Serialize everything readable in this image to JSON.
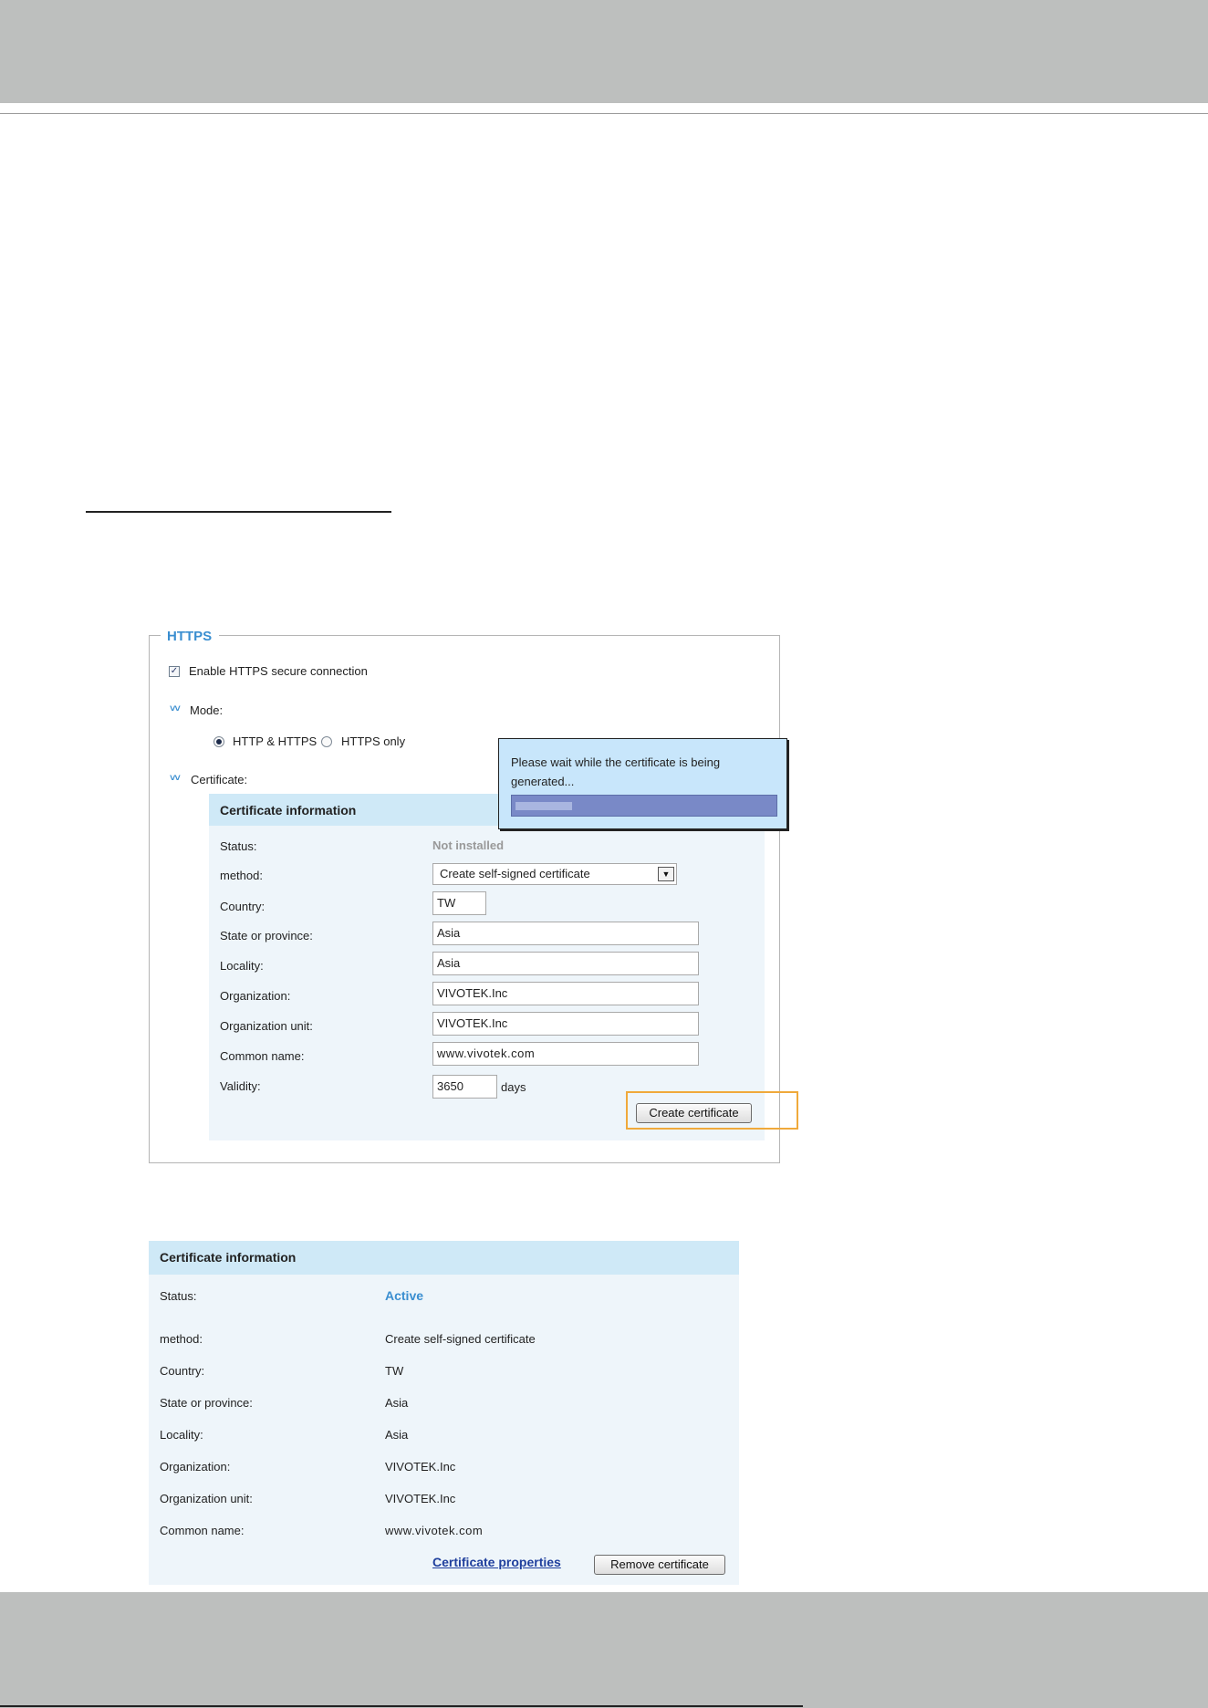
{
  "https_section": {
    "legend": "HTTPS",
    "enable_label": "Enable HTTPS secure connection",
    "enable_checked": true,
    "mode_label": "Mode:",
    "mode_options": [
      {
        "label": "HTTP & HTTPS",
        "selected": true
      },
      {
        "label": "HTTPS only",
        "selected": false
      }
    ],
    "certificate_label": "Certificate:",
    "chevron_glyph": "⨀"
  },
  "certificate_form": {
    "title": "Certificate information",
    "status_label": "Status:",
    "status_value": "Not installed",
    "method_label": "method:",
    "method_value": "Create self-signed certificate",
    "country_label": "Country:",
    "country_value": "TW",
    "state_label": "State or province:",
    "state_value": "Asia",
    "locality_label": "Locality:",
    "locality_value": "Asia",
    "organization_label": "Organization:",
    "organization_value": "VIVOTEK.Inc",
    "org_unit_label": "Organization unit:",
    "org_unit_value": "VIVOTEK.Inc",
    "common_name_label": "Common name:",
    "common_name_value": "www.vivotek.com",
    "validity_label": "Validity:",
    "validity_value": "3650",
    "validity_unit": "days",
    "create_button": "Create certificate"
  },
  "popup": {
    "message": "Please wait while the certificate is being generated...",
    "progress_fraction": 0.22
  },
  "certificate_info": {
    "title": "Certificate information",
    "rows": [
      {
        "label": "Status:",
        "value": "Active"
      },
      {
        "label": "method:",
        "value": "Create self-signed certificate"
      },
      {
        "label": "Country:",
        "value": "TW"
      },
      {
        "label": "State or province:",
        "value": "Asia"
      },
      {
        "label": "Locality:",
        "value": "Asia"
      },
      {
        "label": "Organization:",
        "value": "VIVOTEK.Inc"
      },
      {
        "label": "Organization unit:",
        "value": "VIVOTEK.Inc"
      },
      {
        "label": "Common name:",
        "value": "www.vivotek.com"
      }
    ],
    "properties_link": "Certificate properties",
    "remove_button": "Remove certificate"
  },
  "colors": {
    "accent": "#3a8ed0",
    "header_band": "#bdbfbe",
    "panel_bg": "#eef5fa",
    "panel_head": "#cfe9f7",
    "highlight": "#f0a93b",
    "link": "#1f3f9d"
  }
}
